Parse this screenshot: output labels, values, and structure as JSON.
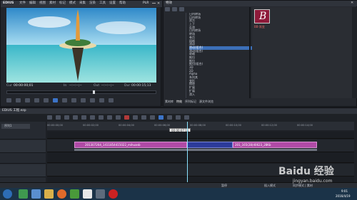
{
  "player": {
    "title": "EDIUS",
    "menu": [
      "文件",
      "编辑",
      "视图",
      "素材",
      "标记",
      "模式",
      "采集",
      "渲染",
      "工具",
      "设置",
      "帮助"
    ],
    "badge": "PLR",
    "cur_label": "Cur",
    "cur_time": "00:00:00;01",
    "in_label": "In",
    "in_time": "--:--:--;--",
    "out_label": "Out",
    "out_time": "--:--:--;--",
    "dur_label": "Dur",
    "dur_time": "00:00:15;13"
  },
  "effects": {
    "tree_items": [
      "日内转场",
      "日内转场",
      "双方",
      "上下",
      "右滑",
      "日内转场",
      "转场",
      "卷页",
      "网格",
      "滑动",
      "滑动(组合)",
      "滑动(组合)",
      "收缩",
      "推拉",
      "推拉",
      "推拉(组合)",
      "3D",
      "2D",
      "Alpha",
      "系列其",
      "变形",
      "擦除",
      "扩展",
      "扩展",
      "滑入",
      "溶化"
    ],
    "selected_index": 10,
    "thumb_letter": "B",
    "thumb_caption": "BB-渐变",
    "tabs": [
      "特效",
      "素材",
      "信息",
      "标记",
      "搜索"
    ],
    "bottom_tabs": [
      "素材库",
      "特效",
      "序列标记",
      "源文件浏览"
    ]
  },
  "timeline": {
    "title": "EDIUS 工程.ezp",
    "sequence": "序列1",
    "ruler": [
      "00:00:00;00",
      "00:00:02;00",
      "00:00:04;00",
      "00:00:06;00",
      "00:00:08;00",
      "00:00:10;00",
      "00:00:12;00",
      "00:00:14;00"
    ],
    "timecode_popup": "00:00:07;15",
    "clip1": "201307264_1411854415022_mihuanb",
    "clip2": "201_165(28)40623_28Kb",
    "status_left": "暂停",
    "status_mid": "插入模式",
    "status_right": "同步模式 | 素材",
    "footer": "jingyan.baidu.com"
  },
  "taskbar": {
    "time": "9:01",
    "date": "2016/4/19"
  },
  "watermark": "Baidu 经验"
}
